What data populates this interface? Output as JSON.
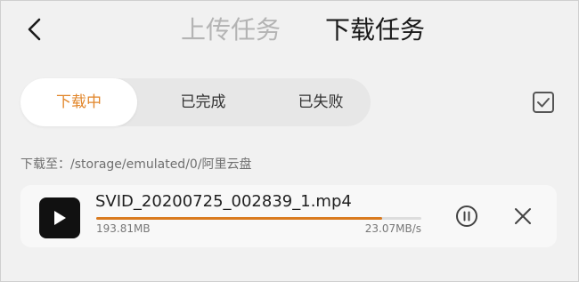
{
  "header": {
    "back_icon": "chevron-left-icon",
    "tabs": [
      {
        "label": "上传任务",
        "active": false
      },
      {
        "label": "下载任务",
        "active": true
      }
    ]
  },
  "filter": {
    "items": [
      {
        "label": "下载中",
        "active": true
      },
      {
        "label": "已完成",
        "active": false
      },
      {
        "label": "已失败",
        "active": false
      }
    ],
    "select_icon": "checkbox-icon"
  },
  "download_path": "下载至：/storage/emulated/0/阿里云盘",
  "task": {
    "file_name": "SVID_20200725_002839_1.mp4",
    "size": "193.81MB",
    "speed": "23.07MB/s",
    "progress": 0.88,
    "file_icon": "play-icon",
    "pause_icon": "pause-circle-icon",
    "cancel_icon": "close-icon"
  },
  "colors": {
    "accent": "#e2862a",
    "progress": "#d97a1f",
    "background": "#f1f1f1"
  }
}
